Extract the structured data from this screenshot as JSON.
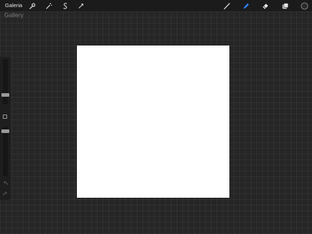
{
  "topbar": {
    "gallery_label": "Galeria",
    "left_tools": [
      "wrench-icon",
      "magic-wand-icon",
      "selection-icon",
      "transform-icon"
    ],
    "right_tools": [
      "brush-icon",
      "smudge-icon",
      "eraser-icon",
      "layers-icon",
      "color-swatch-icon"
    ],
    "active_tool": "smudge",
    "accent_color": "#2f7df6",
    "color_swatch": "#2a2a2a"
  },
  "ghost_label": "Gallery",
  "sidebar": {
    "brush_size_level": 0.68,
    "opacity_level": 0.8,
    "icons": [
      "modify-button-icon",
      "undo-icon",
      "redo-icon"
    ]
  }
}
